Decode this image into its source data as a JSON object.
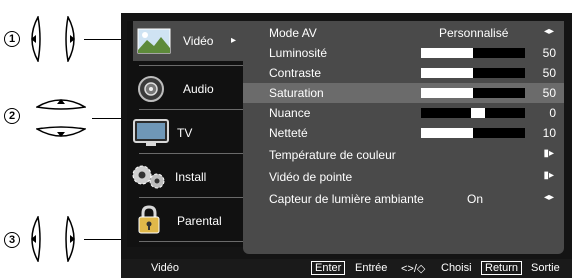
{
  "callouts": [
    {
      "number": "1"
    },
    {
      "number": "2"
    },
    {
      "number": "3"
    }
  ],
  "sidebar": {
    "items": [
      {
        "label": "Vidéo",
        "icon": "picture-icon",
        "active": true,
        "arrow": "▸"
      },
      {
        "label": "Audio",
        "icon": "speaker-icon",
        "active": false
      },
      {
        "label": "TV",
        "icon": "tv-icon",
        "active": false
      },
      {
        "label": "Install",
        "icon": "gears-icon",
        "active": false
      },
      {
        "label": "Parental",
        "icon": "lock-icon",
        "active": false
      }
    ]
  },
  "menu": {
    "rows": [
      {
        "label": "Mode AV",
        "value": "Personnalisé",
        "control": "left-right"
      },
      {
        "label": "Luminosité",
        "level": 50,
        "number": "50",
        "control": "bar"
      },
      {
        "label": "Contraste",
        "level": 50,
        "number": "50",
        "control": "bar"
      },
      {
        "label": "Saturation",
        "level": 50,
        "number": "50",
        "control": "bar",
        "selected": true
      },
      {
        "label": "Nuance",
        "level": 0,
        "number": "0",
        "control": "center-bar"
      },
      {
        "label": "Netteté",
        "level": 10,
        "number": "10",
        "control": "bar"
      },
      {
        "label": "Température de couleur",
        "control": "right"
      },
      {
        "label": "Vidéo de pointe",
        "control": "right"
      },
      {
        "label": "Capteur de lumière ambiante",
        "value": "On",
        "control": "left-right"
      }
    ]
  },
  "footer": {
    "section": "Vidéo",
    "enter_key": "Enter",
    "enter_label": "Entrée",
    "nav_symbols": "<>/◇",
    "nav_label": "Choisi",
    "return_key": "Return",
    "return_label": "Sortie"
  }
}
